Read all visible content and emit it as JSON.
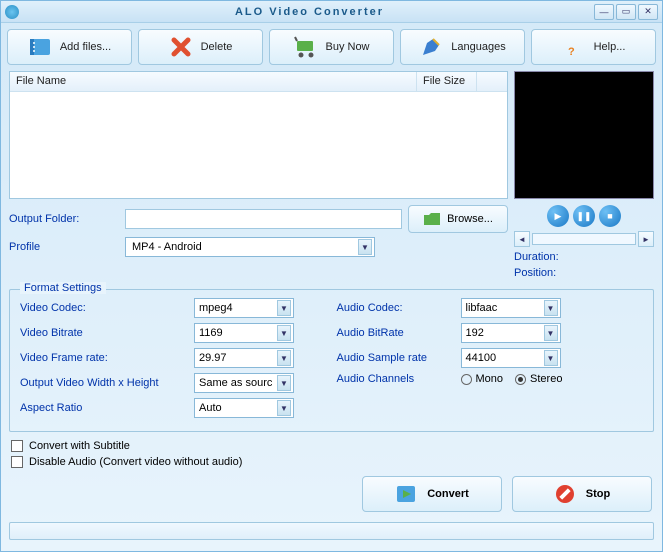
{
  "window": {
    "title": "ALO Video Converter"
  },
  "toolbar": {
    "add": "Add files...",
    "delete": "Delete",
    "buy": "Buy Now",
    "lang": "Languages",
    "help": "Help..."
  },
  "table": {
    "col_name": "File Name",
    "col_size": "File Size"
  },
  "output": {
    "folder_label": "Output Folder:",
    "folder_value": "",
    "browse": "Browse...",
    "profile_label": "Profile",
    "profile_value": "MP4 - Android"
  },
  "player": {
    "duration_label": "Duration:",
    "position_label": "Position:"
  },
  "format": {
    "group_title": "Format Settings",
    "video_codec_label": "Video Codec:",
    "video_codec": "mpeg4",
    "video_bitrate_label": "Video Bitrate",
    "video_bitrate": "1169",
    "video_fps_label": "Video Frame rate:",
    "video_fps": "29.97",
    "video_size_label": "Output Video Width x Height",
    "video_size": "Same as sourc",
    "aspect_label": "Aspect Ratio",
    "aspect": "Auto",
    "audio_codec_label": "Audio Codec:",
    "audio_codec": "libfaac",
    "audio_bitrate_label": "Audio BitRate",
    "audio_bitrate": "192",
    "audio_sample_label": "Audio Sample rate",
    "audio_sample": "44100",
    "audio_channels_label": "Audio Channels",
    "mono": "Mono",
    "stereo": "Stereo"
  },
  "options": {
    "subtitle": "Convert with Subtitle",
    "disable_audio": "Disable Audio (Convert video without audio)"
  },
  "actions": {
    "convert": "Convert",
    "stop": "Stop"
  }
}
